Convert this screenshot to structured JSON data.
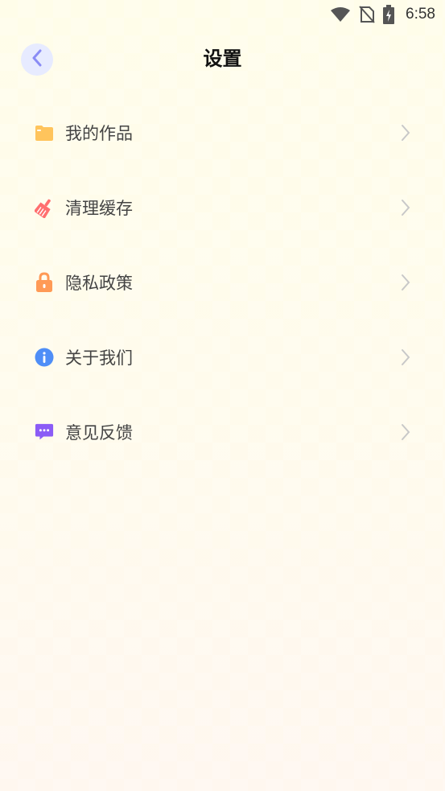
{
  "status_bar": {
    "time": "6:58",
    "icons": [
      "wifi-icon",
      "no-sim-icon",
      "battery-charging-icon"
    ]
  },
  "header": {
    "title": "设置",
    "back_icon": "chevron-left-icon"
  },
  "menu": {
    "items": [
      {
        "label": "我的作品",
        "icon": "folder-icon",
        "color": "#ffc45c"
      },
      {
        "label": "清理缓存",
        "icon": "broom-icon",
        "color": "#ff6f6f"
      },
      {
        "label": "隐私政策",
        "icon": "lock-icon",
        "color": "#ff9a56"
      },
      {
        "label": "关于我们",
        "icon": "info-icon",
        "color": "#4f8ef7"
      },
      {
        "label": "意见反馈",
        "icon": "feedback-icon",
        "color": "#8b5cf6"
      }
    ]
  },
  "colors": {
    "accent": "#8a8cf5",
    "back_bg": "#e7ebff",
    "chevron": "#c8c8c8"
  }
}
